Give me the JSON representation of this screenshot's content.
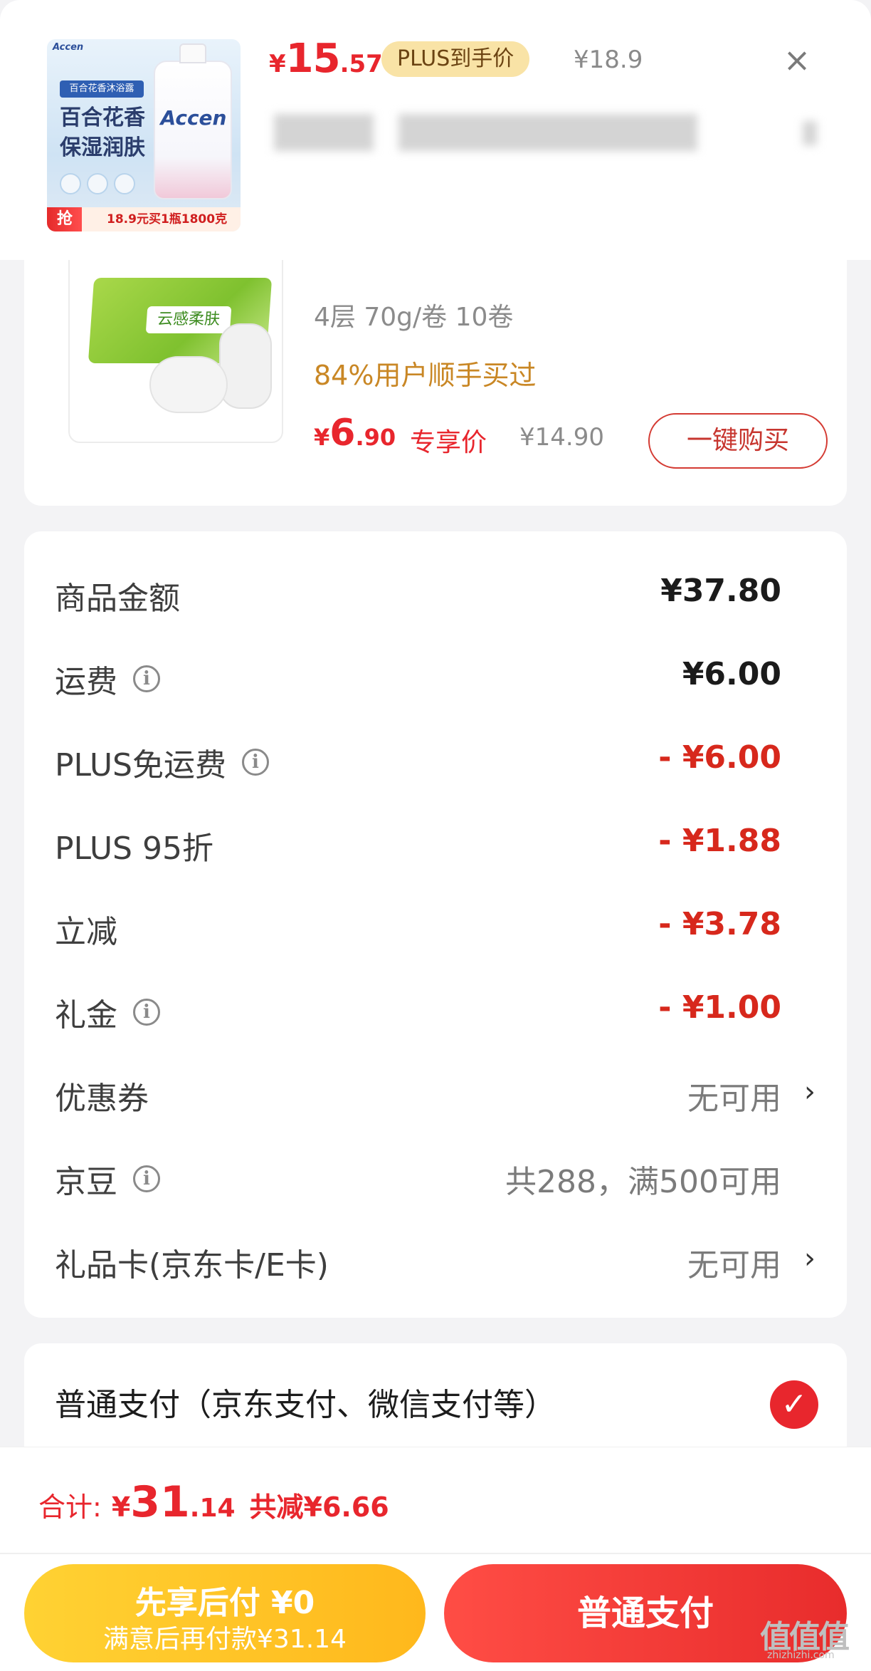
{
  "header": {
    "thumb": {
      "brand": "Accen",
      "tag": "百合花香沐浴露",
      "copy_line1": "百合花香",
      "copy_line2": "保湿润肤",
      "bottle_logo": "Accen",
      "promo_tag": "抢",
      "promo_text": "18.9元买1瓶1800克"
    },
    "price_symbol": "¥",
    "price_int": "15",
    "price_dec": ".57",
    "plus_label": "PLUS到手价",
    "old_price": "¥18.9",
    "close_label": "×"
  },
  "product": {
    "spec": "4层 70g/卷 10卷",
    "buyers": "84%用户顺手买过",
    "price_symbol": "¥",
    "price_int": "6",
    "price_dec": ".90",
    "price_label": "专享价",
    "old_price": "¥14.90",
    "buy_button": "一键购买",
    "pack_label": "云感柔肤"
  },
  "summary": {
    "rows": [
      {
        "label": "商品金额",
        "value": "¥37.80"
      },
      {
        "label": "运费",
        "value": "¥6.00"
      },
      {
        "label": "PLUS免运费",
        "value": "- ¥6.00"
      },
      {
        "label": "PLUS 95折",
        "value": "- ¥1.88"
      },
      {
        "label": "立减",
        "value": "- ¥3.78"
      },
      {
        "label": "礼金",
        "value": "- ¥1.00"
      },
      {
        "label": "优惠券",
        "value": "无可用"
      },
      {
        "label": "京豆",
        "value": "共288，满500可用"
      },
      {
        "label": "礼品卡(京东卡/E卡)",
        "value": "无可用"
      }
    ]
  },
  "payment": {
    "method": "普通支付（京东支付、微信支付等）"
  },
  "bottom": {
    "total_label": "合计:",
    "total_symbol": "¥",
    "total_int": "31",
    "total_dec": ".14",
    "total_save": "共减¥6.66",
    "later_title": "先享后付 ¥0",
    "later_sub": "满意后再付款¥31.14",
    "pay_button": "普通支付"
  },
  "watermark": {
    "main": "值值值",
    "sub": "zhizhizhi.com"
  },
  "colors": {
    "accent_red": "#e8262d",
    "discount_red": "#d7281c",
    "plus_gold": "#f9e3a6",
    "later_yellow": "#ffc226"
  },
  "icons": [
    "close-icon",
    "info-icon",
    "chevron-right-icon",
    "check-icon"
  ]
}
